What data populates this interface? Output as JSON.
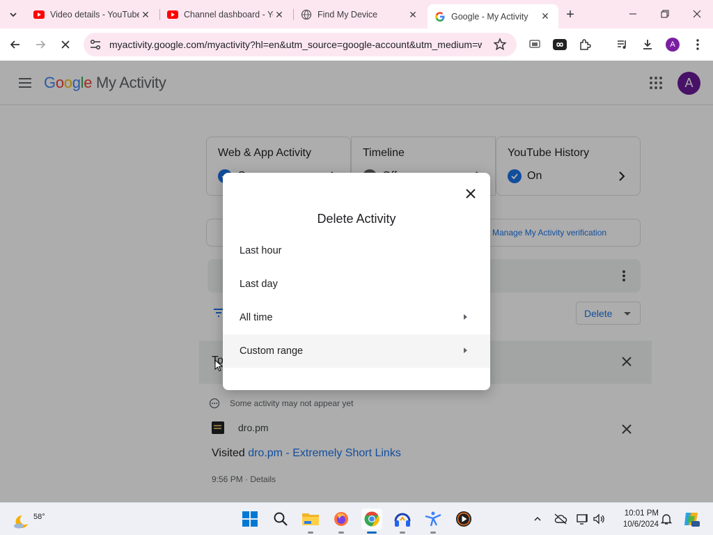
{
  "browser": {
    "tabs": [
      {
        "title": "Video details - YouTube",
        "favicon": "youtube-icon",
        "active": false
      },
      {
        "title": "Channel dashboard - YouTube",
        "favicon": "youtube-icon",
        "active": false
      },
      {
        "title": "Find My Device",
        "favicon": "globe-icon",
        "active": false
      },
      {
        "title": "Google - My Activity",
        "favicon": "google-icon",
        "active": true
      }
    ],
    "new_tab": "+",
    "url": "myactivity.google.com/myactivity?hl=en&utm_source=google-account&utm_medium=web",
    "profile_initial": "A"
  },
  "page": {
    "app_title_google": [
      "G",
      "o",
      "o",
      "g",
      "l",
      "e"
    ],
    "app_title_rest": "My Activity",
    "avatar_initial": "A",
    "controls": [
      {
        "title": "Web & App Activity",
        "status": "On"
      },
      {
        "title": "Timeline",
        "status": "Off"
      },
      {
        "title": "YouTube History",
        "status": "On"
      }
    ],
    "verification_link": "Manage My Activity verification",
    "delete_button": "Delete",
    "today_label": "Today",
    "notice": "Some activity may not appear yet",
    "site_name": "dro.pm",
    "visited_prefix": "Visited",
    "visited_link": "dro.pm - Extremely Short Links",
    "timestamp": "9:56 PM",
    "details_link": "Details"
  },
  "dialog": {
    "title": "Delete Activity",
    "options": [
      {
        "label": "Last hour",
        "submenu": false
      },
      {
        "label": "Last day",
        "submenu": false
      },
      {
        "label": "All time",
        "submenu": true
      },
      {
        "label": "Custom range",
        "submenu": true
      }
    ]
  },
  "taskbar": {
    "temperature": "58°",
    "time": "10:01 PM",
    "date": "10/6/2024"
  },
  "colors": {
    "accent": "#1a73e8",
    "avatar": "#6a1b9a",
    "tabstrip": "#fce7f1"
  }
}
